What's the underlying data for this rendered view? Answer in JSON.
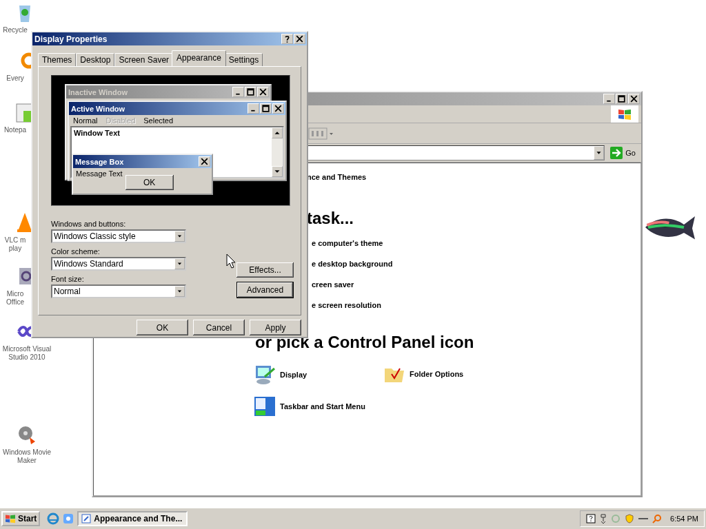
{
  "desktop_icons": [
    {
      "kind": "recycle",
      "label": "Recycle"
    },
    {
      "kind": "ring",
      "label": "Every"
    },
    {
      "kind": "chart",
      "label": "Notepa"
    },
    {
      "kind": "cone",
      "label": "VLC m play"
    },
    {
      "kind": "office",
      "label": "Micro Office"
    },
    {
      "kind": "infinity",
      "label": "Microsoft Visual Studio 2010"
    },
    {
      "kind": "film",
      "label": "Windows Movie Maker"
    }
  ],
  "control_panel": {
    "go": "Go",
    "category": "nce and Themes",
    "task_heading": "task...",
    "tasks": [
      "e computer's theme",
      "e desktop background",
      "creen saver",
      "e screen resolution"
    ],
    "icon_heading": "or pick a Control Panel icon",
    "icons": [
      {
        "kind": "display",
        "label": "Display"
      },
      {
        "kind": "folder",
        "label": "Folder Options"
      },
      {
        "kind": "taskbar",
        "label": "Taskbar and Start Menu"
      }
    ]
  },
  "dialog": {
    "title": "Display Properties",
    "tabs": [
      {
        "label": "Themes",
        "selected": false
      },
      {
        "label": "Desktop",
        "selected": false
      },
      {
        "label": "Screen Saver",
        "selected": false
      },
      {
        "label": "Appearance",
        "selected": true
      },
      {
        "label": "Settings",
        "selected": false
      }
    ],
    "preview": {
      "inactive_title": "Inactive Window",
      "active_title": "Active Window",
      "menu": [
        {
          "label": "Normal",
          "disabled": false
        },
        {
          "label": "Disabled",
          "disabled": true
        },
        {
          "label": "Selected",
          "disabled": false
        }
      ],
      "window_text": "Window Text",
      "message_title": "Message Box",
      "message_text": "Message Text",
      "message_button": "OK"
    },
    "fields": [
      {
        "label": "Windows and buttons:",
        "value": "Windows Classic style"
      },
      {
        "label": "Color scheme:",
        "value": "Windows Standard"
      },
      {
        "label": "Font size:",
        "value": "Normal"
      }
    ],
    "side_buttons": [
      {
        "label": "Effects...",
        "default": false
      },
      {
        "label": "Advanced",
        "default": true
      }
    ],
    "buttons": [
      "OK",
      "Cancel",
      "Apply"
    ]
  },
  "taskbar": {
    "start": "Start",
    "tasks": [
      {
        "label": "Appearance and The...",
        "selected": true
      }
    ],
    "clock": "6:54 PM"
  }
}
